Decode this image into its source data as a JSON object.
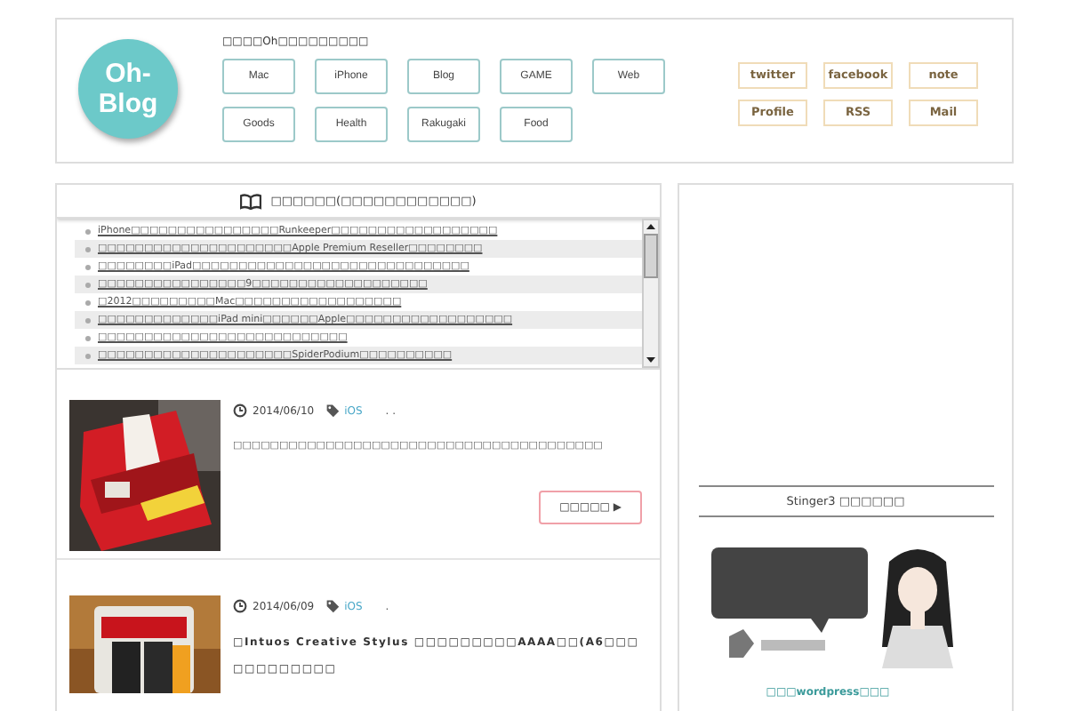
{
  "header": {
    "logo": [
      "Oh-",
      "Blog"
    ],
    "tagline": "□□□□Oh□□□□□□□□□",
    "nav": [
      [
        "Mac",
        "iPhone",
        "Blog",
        "GAME",
        "Web"
      ],
      [
        "Goods",
        "Health",
        "Rakugaki",
        "Food"
      ]
    ],
    "social": [
      [
        "twitter",
        "facebook",
        "note"
      ],
      [
        "Profile",
        "RSS",
        "Mail"
      ]
    ]
  },
  "recent": {
    "title": "□□□□□□(□□□□□□□□□□□□)",
    "items": [
      {
        "text": "iPhone□□□□□□□□□□□□□□□□Runkeeper□□□□□□□□□□□□□□□□□□"
      },
      {
        "text": "□□□□□□□□□□□□□□□□□□□□□Apple Premium Reseller□□□□□□□□"
      },
      {
        "text": "□□□□□□□□iPad□□□□□□□□□□□□□□□□□□□□□□□□□□□□□□"
      },
      {
        "text": "□□□□□□□□□□□□□□□□9□□□□□□□□□□□□□□□□□□□"
      },
      {
        "text": "□2012□□□□□□□□□Mac□□□□□□□□□□□□□□□□□□"
      },
      {
        "text": "□□□□□□□□□□□□□iPad mini□□□□□□Apple□□□□□□□□□□□□□□□□□□"
      },
      {
        "text": "□□□□□□□□□□□□□□□□□□□□□□□□□□□"
      },
      {
        "text": "□□□□□□□□□□□□□□□□□□□□□SpiderPodium□□□□□□□□□□"
      }
    ]
  },
  "posts": [
    {
      "date": "2014/06/10",
      "tag": "iOS",
      "extra": ". .",
      "title": "□□□□□□□□□□□□□□□□□□□□□□□□□□□□□□□□□□□□□□□□",
      "more": "□□□□□ ▶",
      "bold": false
    },
    {
      "date": "2014/06/09",
      "tag": "iOS",
      "extra": ".",
      "title": "□Intuos Creative Stylus □□□□□□□□□AAAA□□(A6□□□□□□□□□□□□",
      "bold": true
    }
  ],
  "sidebar": {
    "heading": "Stinger3 □□□□□□",
    "link": "□□□wordpress□□□"
  }
}
